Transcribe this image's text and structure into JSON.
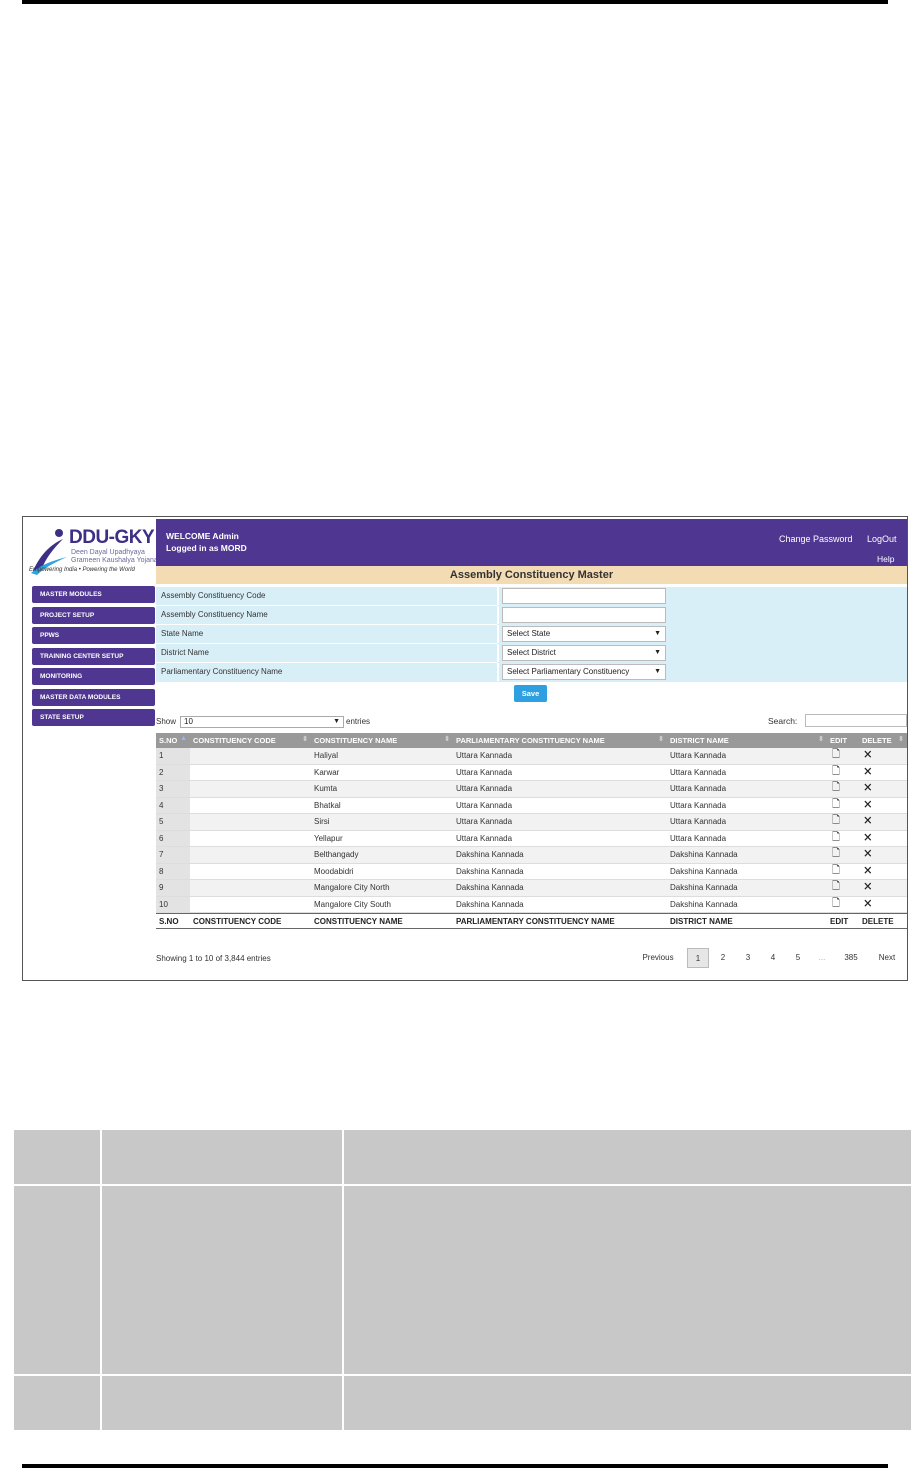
{
  "app": {
    "logo_text": "DDU-GKY",
    "logo_sub1": "Deen Dayal Upadhyaya",
    "logo_sub2": "Grameen Kaushalya Yojana",
    "logo_tagline": "Empowering India • Powering the World"
  },
  "header": {
    "welcome": "WELCOME  Admin",
    "logged_in": "Logged in as   MORD",
    "change_password": "Change Password",
    "logout": "LogOut",
    "help": "Help"
  },
  "page_title": "Assembly Constituency Master",
  "sidebar": {
    "items": [
      {
        "label": "MASTER MODULES"
      },
      {
        "label": "PROJECT SETUP"
      },
      {
        "label": "PPWS"
      },
      {
        "label": "TRAINING CENTER SETUP"
      },
      {
        "label": "MONITORING"
      },
      {
        "label": "MASTER DATA MODULES"
      },
      {
        "label": "STATE SETUP"
      }
    ]
  },
  "form": {
    "code_label": "Assembly Constituency Code",
    "code_value": "",
    "name_label": "Assembly Constituency Name",
    "name_value": "",
    "state_label": "State Name",
    "state_value": "Select State",
    "district_label": "District Name",
    "district_value": "Select District",
    "pc_label": "Parliamentary Constituency Name",
    "pc_value": "Select Parliamentary Constituency",
    "save": "Save"
  },
  "table_controls": {
    "show": "Show",
    "page_size": "10",
    "entries": "entries",
    "search_label": "Search:",
    "search_value": ""
  },
  "table": {
    "columns": [
      "S.NO",
      "CONSTITUENCY CODE",
      "CONSTITUENCY NAME",
      "PARLIAMENTARY CONSTITUENCY NAME",
      "DISTRICT NAME",
      "EDIT",
      "DELETE"
    ],
    "rows": [
      {
        "sno": "1",
        "code": "",
        "name": "Haliyal",
        "pc": "Uttara Kannada",
        "district": "Uttara Kannada"
      },
      {
        "sno": "2",
        "code": "",
        "name": "Karwar",
        "pc": "Uttara Kannada",
        "district": "Uttara Kannada"
      },
      {
        "sno": "3",
        "code": "",
        "name": "Kumta",
        "pc": "Uttara Kannada",
        "district": "Uttara Kannada"
      },
      {
        "sno": "4",
        "code": "",
        "name": "Bhatkal",
        "pc": "Uttara Kannada",
        "district": "Uttara Kannada"
      },
      {
        "sno": "5",
        "code": "",
        "name": "Sirsi",
        "pc": "Uttara Kannada",
        "district": "Uttara Kannada"
      },
      {
        "sno": "6",
        "code": "",
        "name": "Yellapur",
        "pc": "Uttara Kannada",
        "district": "Uttara Kannada"
      },
      {
        "sno": "7",
        "code": "",
        "name": "Belthangady",
        "pc": "Dakshina Kannada",
        "district": "Dakshina Kannada"
      },
      {
        "sno": "8",
        "code": "",
        "name": "Moodabidri",
        "pc": "Dakshina Kannada",
        "district": "Dakshina Kannada"
      },
      {
        "sno": "9",
        "code": "",
        "name": "Mangalore City North",
        "pc": "Dakshina Kannada",
        "district": "Dakshina Kannada"
      },
      {
        "sno": "10",
        "code": "",
        "name": "Mangalore City South",
        "pc": "Dakshina Kannada",
        "district": "Dakshina Kannada"
      }
    ],
    "edit_icon": "edit-icon",
    "delete_icon": "delete-icon"
  },
  "pagination": {
    "info": "Showing 1 to 10 of 3,844 entries",
    "previous": "Previous",
    "pages": [
      "1",
      "2",
      "3",
      "4",
      "5",
      "...",
      "385"
    ],
    "next": "Next",
    "current": "1"
  },
  "colors": {
    "header_purple": "#4e3691",
    "title_bar": "#f3dbb4",
    "form_bg": "#d9eff8",
    "save_blue": "#2e9fe0",
    "doc_table_gray": "#c8c8c8"
  }
}
